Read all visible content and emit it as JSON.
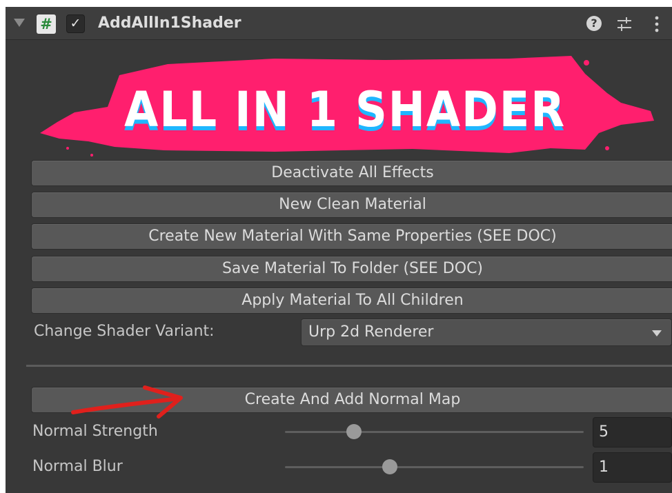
{
  "header": {
    "title": "AddAllIn1Shader",
    "script_icon": "#",
    "checkbox_mark": "✓",
    "help_glyph": "?"
  },
  "banner": {
    "text": "ALL IN 1 SHADER",
    "colors": {
      "splash": "#ff1f6e",
      "text": "#ffffff",
      "shadow": "#1fb6ff"
    }
  },
  "buttons": {
    "deactivate": "Deactivate All Effects",
    "new_clean": "New Clean Material",
    "create_same": "Create New Material With Same Properties (SEE DOC)",
    "save_folder": "Save Material To Folder (SEE DOC)",
    "apply_children": "Apply Material To All Children",
    "create_normal": "Create And Add Normal Map"
  },
  "variant": {
    "label": "Change Shader Variant:",
    "selected": "Urp 2d Renderer"
  },
  "normal_strength": {
    "label": "Normal Strength",
    "value": "5",
    "slider_fraction": 0.23
  },
  "normal_blur": {
    "label": "Normal Blur",
    "value": "1",
    "slider_fraction": 0.35
  },
  "annotation_color": "#e0201c"
}
